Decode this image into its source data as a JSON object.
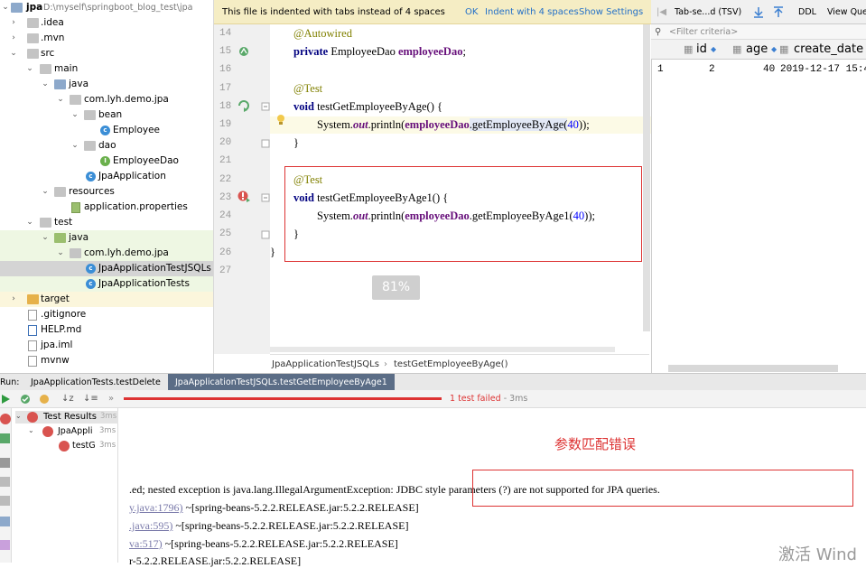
{
  "project": {
    "root_name": "jpa",
    "root_path": "D:\\myself\\springboot_blog_test\\jpa",
    "items": [
      {
        "label": ".idea"
      },
      {
        "label": ".mvn"
      },
      {
        "label": "src"
      },
      {
        "label": "main"
      },
      {
        "label": "java"
      },
      {
        "label": "com.lyh.demo.jpa"
      },
      {
        "label": "bean"
      },
      {
        "label": "Employee"
      },
      {
        "label": "dao"
      },
      {
        "label": "EmployeeDao"
      },
      {
        "label": "JpaApplication"
      },
      {
        "label": "resources"
      },
      {
        "label": "application.properties"
      },
      {
        "label": "test"
      },
      {
        "label": "java"
      },
      {
        "label": "com.lyh.demo.jpa"
      },
      {
        "label": "JpaApplicationTestJSQLs"
      },
      {
        "label": "JpaApplicationTests"
      },
      {
        "label": "target"
      },
      {
        "label": ".gitignore"
      },
      {
        "label": "HELP.md"
      },
      {
        "label": "jpa.iml"
      },
      {
        "label": "mvnw"
      }
    ]
  },
  "editor": {
    "banner": {
      "text": "This file is indented with tabs instead of 4 spaces",
      "ok": "OK",
      "indent": "Indent with 4 spaces",
      "settings": "Show Settings"
    },
    "lines": [
      "14",
      "15",
      "16",
      "17",
      "18",
      "19",
      "20",
      "21",
      "22",
      "23",
      "24",
      "25",
      "26",
      "27"
    ],
    "code": {
      "l14": "@Autowired",
      "l15_kw": "private",
      "l15_type": " EmployeeDao ",
      "l15_var": "employeeDao",
      "l15_end": ";",
      "l17": "@Test",
      "l18_kw": "void",
      "l18_rest": " testGetEmployeeByAge() {",
      "l19_a": "System.",
      "l19_out": "out",
      "l19_b": ".println(",
      "l19_fld": "employeeDao",
      "l19_c": ".getEmployeeByAge(",
      "l19_num": "40",
      "l19_d": "));",
      "l20": "}",
      "l22": "@Test",
      "l23_kw": "void",
      "l23_rest": " testGetEmployeeByAge1() {",
      "l24_a": "System.",
      "l24_out": "out",
      "l24_b": ".println(",
      "l24_fld": "employeeDao",
      "l24_c": ".getEmployeeByAge1(",
      "l24_num": "40",
      "l24_d": "));",
      "l25": "}",
      "l26": "}"
    },
    "zoom": "81%",
    "breadcrumb": {
      "class_name": "JpaApplicationTestJSQLs",
      "sep": "›",
      "method": "testGetEmployeeByAge()"
    }
  },
  "db": {
    "toolbar": {
      "format": "Tab-se...d (TSV)",
      "ddl": "DDL",
      "view": "View Quer"
    },
    "filter_placeholder": "<Filter criteria>",
    "columns": [
      "id",
      "age",
      "create_date"
    ],
    "row": {
      "index": "1",
      "id": "2",
      "age": "40",
      "create_date": "2019-12-17 15:4"
    }
  },
  "run": {
    "label": "Run:",
    "tabs": [
      "JpaApplicationTests.testDelete",
      "JpaApplicationTestJSQLs.testGetEmployeeByAge1"
    ],
    "status": "1 test failed",
    "status_time": "- 3ms",
    "tree": {
      "root": "Test Results",
      "root_time": "3ms",
      "child": "JpaAppli",
      "child_time": "3ms",
      "leaf": "testG",
      "leaf_time": "3ms"
    },
    "note": "参数匹配错误",
    "console": {
      "l1": ".ed; nested exception is java.lang.IllegalArgumentException: JDBC style parameters (?) are not supported for JPA queries.",
      "l2_link": "y.java:1796)",
      "l2_rest": " ~[spring-beans-5.2.2.RELEASE.jar:5.2.2.RELEASE]",
      "l3_link": ".java:595)",
      "l3_rest": " ~[spring-beans-5.2.2.RELEASE.jar:5.2.2.RELEASE]",
      "l4_link": "va:517)",
      "l4_rest": " ~[spring-beans-5.2.2.RELEASE.jar:5.2.2.RELEASE]",
      "l5": "r-5.2.2.RELEASE.jar:5.2.2.RELEASE]"
    }
  },
  "watermark": "激活 Wind"
}
